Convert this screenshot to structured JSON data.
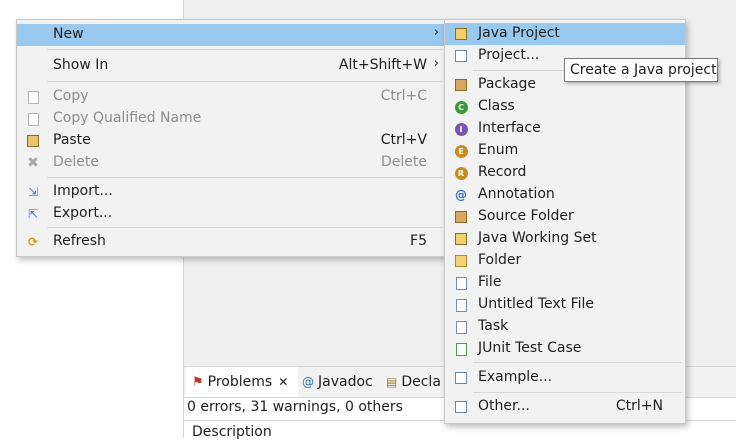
{
  "context_menu": {
    "items": [
      {
        "label": "New",
        "shortcut": "",
        "arrow": "›"
      },
      {
        "label": "Show In",
        "shortcut": "Alt+Shift+W",
        "arrow": "›"
      },
      {
        "label": "Copy",
        "shortcut": "Ctrl+C"
      },
      {
        "label": "Copy Qualified Name",
        "shortcut": ""
      },
      {
        "label": "Paste",
        "shortcut": "Ctrl+V"
      },
      {
        "label": "Delete",
        "shortcut": "Delete"
      },
      {
        "label": "Import...",
        "shortcut": ""
      },
      {
        "label": "Export...",
        "shortcut": ""
      },
      {
        "label": "Refresh",
        "shortcut": "F5"
      }
    ]
  },
  "submenu_new": {
    "items": [
      {
        "label": "Java Project"
      },
      {
        "label": "Project..."
      },
      {
        "label": "Package"
      },
      {
        "label": "Class"
      },
      {
        "label": "Interface"
      },
      {
        "label": "Enum"
      },
      {
        "label": "Record"
      },
      {
        "label": "Annotation"
      },
      {
        "label": "Source Folder"
      },
      {
        "label": "Java Working Set"
      },
      {
        "label": "Folder"
      },
      {
        "label": "File"
      },
      {
        "label": "Untitled Text File"
      },
      {
        "label": "Task"
      },
      {
        "label": "JUnit Test Case"
      },
      {
        "label": "Example..."
      },
      {
        "label": "Other...",
        "shortcut": "Ctrl+N"
      }
    ]
  },
  "tooltip": {
    "text": "Create a Java project"
  },
  "bottom_panel": {
    "tabs": [
      {
        "label": "Problems",
        "close": "✕"
      },
      {
        "label": "Javadoc"
      },
      {
        "label": "Decla"
      }
    ],
    "status": "0 errors, 31 warnings, 0 others",
    "column_header": "Description"
  },
  "colors": {
    "highlight": "#99c9ef",
    "menu_bg": "#f2f2f2",
    "disabled": "#8d8d8d"
  }
}
